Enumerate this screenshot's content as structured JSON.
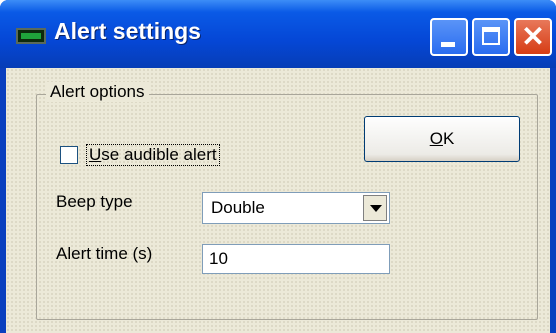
{
  "window": {
    "title": "Alert settings",
    "titlebar_color": "#0547d6",
    "close_button_color": "#d63c14",
    "icon": "app-window-icon"
  },
  "title_buttons": {
    "minimize_icon": "minimize-icon",
    "maximize_icon": "maximize-icon",
    "close_icon": "close-icon",
    "close_glyph": "✕"
  },
  "group": {
    "label": "Alert options"
  },
  "checkbox": {
    "label_mnemonic": "U",
    "label_rest": "se audible alert",
    "checked": false
  },
  "ok_button": {
    "mnemonic": "O",
    "rest": "K"
  },
  "beep": {
    "label": "Beep type",
    "selected": "Double"
  },
  "alert_time": {
    "label": "Alert time (s)",
    "value": "10"
  },
  "client_bg_color": "#ece9d8"
}
